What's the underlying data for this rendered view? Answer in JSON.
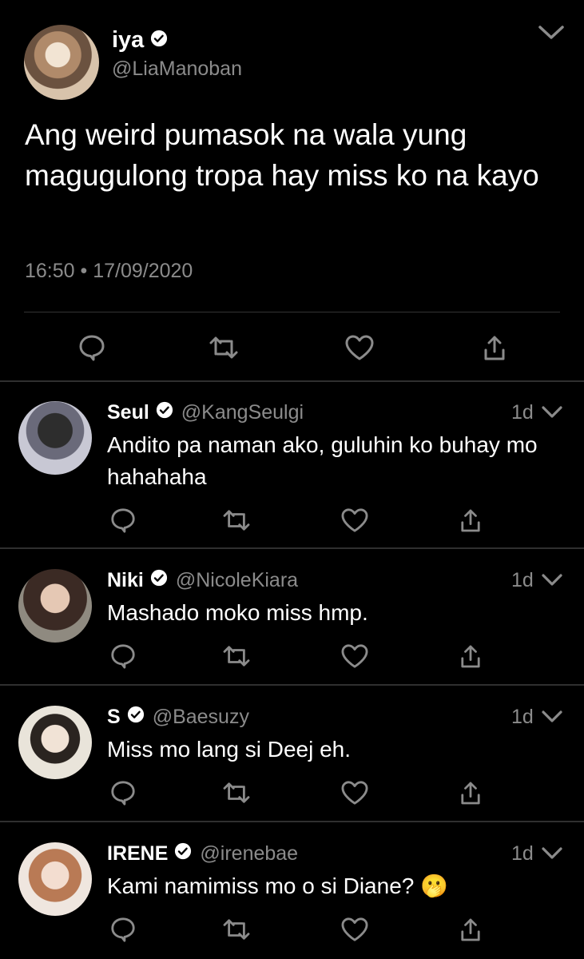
{
  "main": {
    "name": "iya",
    "handle": "@LiaManoban",
    "text": "Ang weird pumasok na wala yung magugulong tropa hay miss ko na kayo",
    "timestamp": "16:50 • 17/09/2020"
  },
  "replies": [
    {
      "name": "Seul",
      "handle": "@KangSeulgi",
      "time": "1d",
      "text": "Andito pa naman ako, guluhin ko buhay mo hahahaha"
    },
    {
      "name": "Niki",
      "handle": "@NicoleKiara",
      "time": "1d",
      "text": "Mashado moko miss hmp."
    },
    {
      "name": "S",
      "handle": "@Baesuzy",
      "time": "1d",
      "text": "Miss mo lang si Deej eh."
    },
    {
      "name": "IRENE",
      "handle": "@irenebae",
      "time": "1d",
      "text": "Kami namimiss mo o si Diane? 🫢"
    }
  ],
  "icons": {
    "verified": "verified-badge-icon",
    "reply": "reply-icon",
    "retweet": "retweet-icon",
    "like": "like-icon",
    "share": "share-icon",
    "more": "chevron-down-icon"
  },
  "colors": {
    "background": "#000000",
    "text": "#ffffff",
    "secondary": "#8b8b8b",
    "divider": "#2f2f2f"
  }
}
